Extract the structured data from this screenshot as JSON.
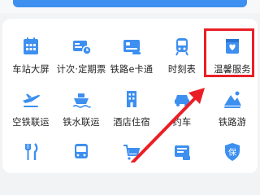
{
  "colors": {
    "accent": "#3d8ff0",
    "highlight": "#ea1f26",
    "background": "#f2f3f5"
  },
  "grid": {
    "rows": [
      [
        {
          "label": "车站大屏",
          "icon": "calendar-screen-icon"
        },
        {
          "label": "计次·定期票",
          "icon": "ticket-card-icon"
        },
        {
          "label": "铁路e卡通",
          "icon": "railway-card-icon"
        },
        {
          "label": "时刻表",
          "icon": "train-front-icon"
        },
        {
          "label": "温馨服务",
          "icon": "heart-bag-icon"
        }
      ],
      [
        {
          "label": "空铁联运",
          "icon": "plane-icon"
        },
        {
          "label": "铁水联运",
          "icon": "ship-icon"
        },
        {
          "label": "酒店住宿",
          "icon": "hotel-building-icon"
        },
        {
          "label": "约车",
          "icon": "car-icon"
        },
        {
          "label": "铁路游",
          "icon": "mountain-travel-icon"
        }
      ],
      [
        {
          "label": "",
          "icon": "fork-knife-icon"
        },
        {
          "label": "",
          "icon": "bus-icon"
        },
        {
          "label": "",
          "icon": "shopping-cart-icon"
        },
        {
          "label": "",
          "icon": "ticket-scan-icon"
        },
        {
          "label": "保",
          "icon": "insurance-shield-icon"
        }
      ]
    ]
  }
}
